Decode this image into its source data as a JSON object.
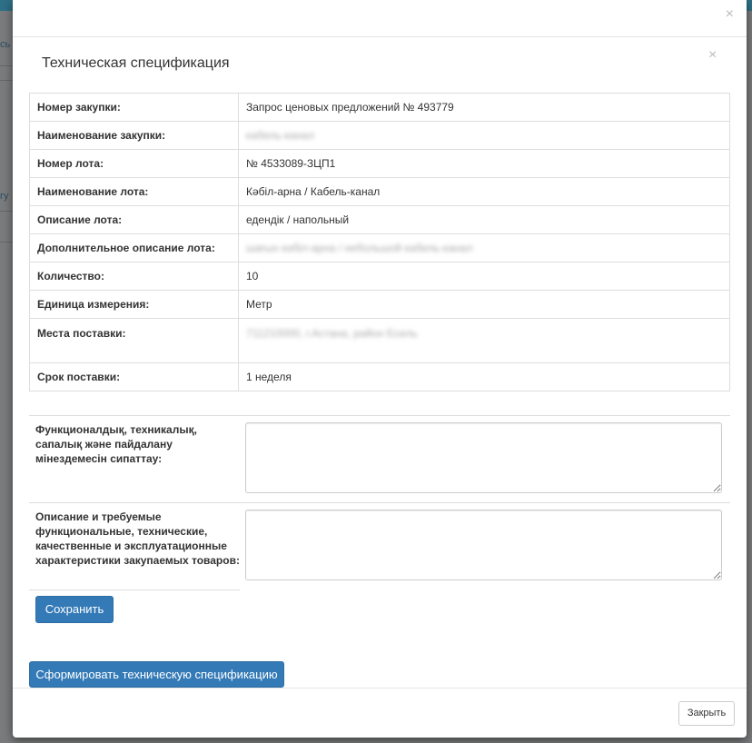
{
  "background": {
    "fragments": [
      "сь",
      "гу"
    ]
  },
  "modal": {
    "close_glyph": "×",
    "title": "Техническая спецификация",
    "inner_close_glyph": "×"
  },
  "spec_table": {
    "rows": [
      {
        "label": "Номер закупки:",
        "value": "Запрос ценовых предложений № 493779"
      },
      {
        "label": "Наименование закупки:",
        "value": "кабель-канал",
        "blurred": true
      },
      {
        "label": "Номер лота:",
        "value": "№ 4533089-ЗЦП1"
      },
      {
        "label": "Наименование лота:",
        "value": "Кәбіл-арна / Кабель-канал"
      },
      {
        "label": "Описание лота:",
        "value": "едендік / напольный"
      },
      {
        "label": "Дополнительное описание лота:",
        "value": "шағын кәбіл-арна / небольшой кабель-канал",
        "blurred": true
      },
      {
        "label": "Количество:",
        "value": "10"
      },
      {
        "label": "Единица измерения:",
        "value": "Метр"
      },
      {
        "label": "Места поставки:",
        "value": "711210000, г.Астана, район Есиль",
        "blurred": true
      },
      {
        "label": "Срок поставки:",
        "value": "1 неделя"
      }
    ]
  },
  "form": {
    "kz_label": "Функционалдық, техникалық, сапалық және пайдалану мінездемесін сипаттау:",
    "kz_value": "",
    "ru_label": "Описание и требуемые функциональные, технические, качественные и эксплуатационные характеристики закупаемых товаров:",
    "ru_value": "",
    "save_label": "Сохранить"
  },
  "generate_label": "Сформировать техническую спецификацию",
  "footer": {
    "close_label": "Закрыть"
  },
  "colors": {
    "primary": "#337ab7",
    "border": "#dddddd"
  }
}
